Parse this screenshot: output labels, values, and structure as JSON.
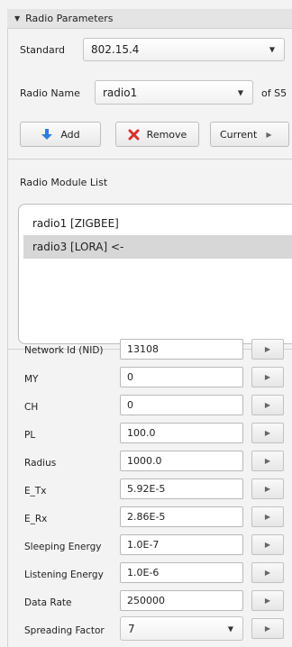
{
  "panel": {
    "title": "Radio Parameters",
    "collapse_icon": "triangle-down-icon"
  },
  "standard": {
    "label": "Standard",
    "value": "802.15.4"
  },
  "radio_name": {
    "label": "Radio Name",
    "value": "radio1",
    "suffix": "of S5"
  },
  "buttons": {
    "add": "Add",
    "remove": "Remove",
    "current": "Current"
  },
  "colors": {
    "add_icon": "#2f7de1",
    "remove_icon": "#d9302c"
  },
  "module_list": {
    "label": "Radio Module List",
    "items": [
      "radio1 [ZIGBEE]",
      "radio3 [LORA] <-"
    ],
    "selected_index": 1
  },
  "params": [
    {
      "label": "Network Id (NID)",
      "value": "13108"
    },
    {
      "label": "MY",
      "value": "0"
    },
    {
      "label": "CH",
      "value": "0"
    },
    {
      "label": "PL",
      "value": "100.0"
    },
    {
      "label": "Radius",
      "value": "1000.0"
    },
    {
      "label": "E_Tx",
      "value": "5.92E-5"
    },
    {
      "label": "E_Rx",
      "value": "2.86E-5"
    },
    {
      "label": "Sleeping Energy",
      "value": "1.0E-7"
    },
    {
      "label": "Listening Energy",
      "value": "1.0E-6"
    },
    {
      "label": "Data Rate",
      "value": "250000"
    },
    {
      "label": "Spreading Factor",
      "value": "7"
    }
  ]
}
